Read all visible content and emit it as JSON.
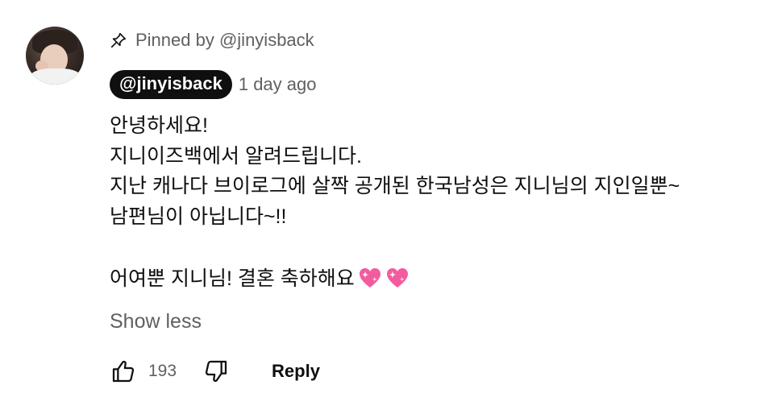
{
  "comment": {
    "pinned_text": "Pinned by @jinyisback",
    "author": "@jinyisback",
    "time": "1 day ago",
    "lines": [
      "안녕하세요!",
      "지니이즈백에서 알려드립니다.",
      "지난 캐나다 브이로그에 살짝 공개된 한국남성은 지니님의 지인일뿐~",
      "남편님이 아닙니다~!!"
    ],
    "last_line": "어여뿐 지니님! 결혼 축하해요",
    "hearts": [
      "sparkling-heart-emoji",
      "sparkling-heart-emoji"
    ],
    "show_less": "Show less",
    "likes": "193",
    "reply": "Reply"
  },
  "icons": {
    "pin": "pin-icon",
    "like": "thumbs-up-icon",
    "dislike": "thumbs-down-icon"
  },
  "colors": {
    "text_primary": "#0f0f0f",
    "text_secondary": "#606060",
    "author_chip_bg": "#0f0f0f",
    "heart_pink": "#f25c9f"
  }
}
